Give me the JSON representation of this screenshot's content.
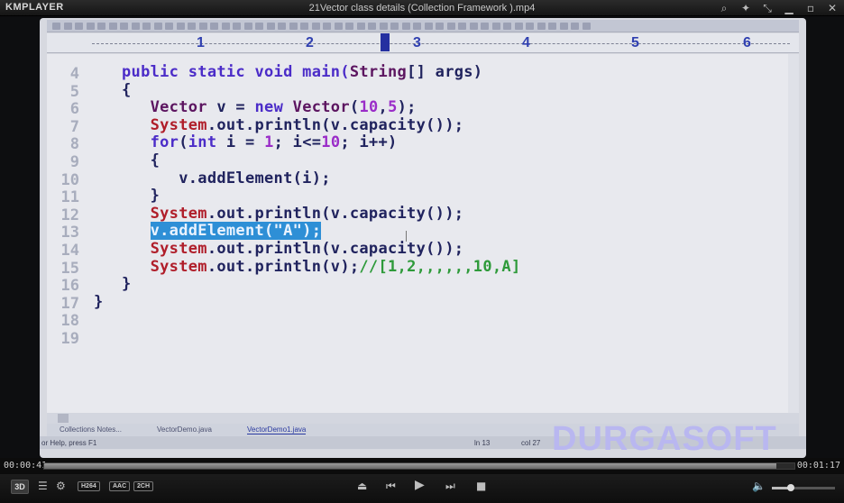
{
  "window": {
    "logo": "KMPLAYER",
    "title": "21Vector class details (Collection Framework ).mp4",
    "controls": [
      "search-icon",
      "pin-icon",
      "shrink-icon",
      "minimize-icon",
      "maximize-icon",
      "close-icon"
    ]
  },
  "ruler": {
    "numbers": [
      "1",
      "2",
      "3",
      "4",
      "5",
      "6"
    ]
  },
  "editor": {
    "line_numbers": [
      "4",
      "5",
      "6",
      "7",
      "8",
      "9",
      "10",
      "11",
      "12",
      "13",
      "14",
      "15",
      "16",
      "17",
      "18",
      "19"
    ],
    "lines": [
      [
        {
          "t": "public static void main(",
          "c": "kw"
        },
        {
          "t": "String",
          "c": "ty"
        },
        {
          "t": "[] args)",
          "c": ""
        }
      ],
      [
        {
          "t": "{",
          "c": ""
        }
      ],
      [
        {
          "t": "   ",
          "c": ""
        },
        {
          "t": "Vector",
          "c": "ty"
        },
        {
          "t": " v = ",
          "c": ""
        },
        {
          "t": "new",
          "c": "kw"
        },
        {
          "t": " ",
          "c": ""
        },
        {
          "t": "Vector",
          "c": "ty"
        },
        {
          "t": "(",
          "c": ""
        },
        {
          "t": "10",
          "c": "num"
        },
        {
          "t": ",",
          "c": ""
        },
        {
          "t": "5",
          "c": "num"
        },
        {
          "t": ");",
          "c": ""
        }
      ],
      [
        {
          "t": "   ",
          "c": ""
        },
        {
          "t": "System",
          "c": "sys"
        },
        {
          "t": ".out.println(v.capacity());",
          "c": ""
        }
      ],
      [
        {
          "t": "   ",
          "c": ""
        },
        {
          "t": "for",
          "c": "kw"
        },
        {
          "t": "(",
          "c": ""
        },
        {
          "t": "int",
          "c": "kw"
        },
        {
          "t": " i = ",
          "c": ""
        },
        {
          "t": "1",
          "c": "num"
        },
        {
          "t": "; i<=",
          "c": ""
        },
        {
          "t": "10",
          "c": "num"
        },
        {
          "t": "; i++)",
          "c": ""
        }
      ],
      [
        {
          "t": "   {",
          "c": ""
        }
      ],
      [
        {
          "t": "      v.addElement(i);",
          "c": ""
        }
      ],
      [
        {
          "t": "   }",
          "c": ""
        }
      ],
      [
        {
          "t": "   ",
          "c": ""
        },
        {
          "t": "System",
          "c": "sys"
        },
        {
          "t": ".out.println(v.capacity());",
          "c": ""
        }
      ],
      [
        {
          "t": "   ",
          "c": ""
        },
        {
          "t": "v.addElement(\"A\");",
          "c": "sel"
        }
      ],
      [
        {
          "t": "   ",
          "c": ""
        },
        {
          "t": "System",
          "c": "sys"
        },
        {
          "t": ".out.println(v.capacity());",
          "c": ""
        }
      ],
      [
        {
          "t": "   ",
          "c": ""
        },
        {
          "t": "System",
          "c": "sys"
        },
        {
          "t": ".out.println(v);",
          "c": ""
        },
        {
          "t": "//[1,2,,,,,,10,A]",
          "c": "cm"
        }
      ],
      [
        {
          "t": "}",
          "c": ""
        }
      ],
      [
        {
          "t": "}",
          "c": "",
          "outer": true
        }
      ],
      [],
      []
    ]
  },
  "tabs": [
    {
      "label": "Collections Notes...",
      "active": false
    },
    {
      "label": "VectorDemo.java",
      "active": false
    },
    {
      "label": "VectorDemo1.java",
      "active": true
    }
  ],
  "status": {
    "help": "or Help, press F1",
    "line": "ln 13",
    "col": "col 27"
  },
  "watermark": "DURGASOFT",
  "player": {
    "time_elapsed": "00:00:41",
    "time_total": "00:01:17",
    "progress": 0.976,
    "badges": [
      "H264",
      "AAC",
      "2CH"
    ],
    "btn_3d": "3D",
    "volume": 0.3
  }
}
